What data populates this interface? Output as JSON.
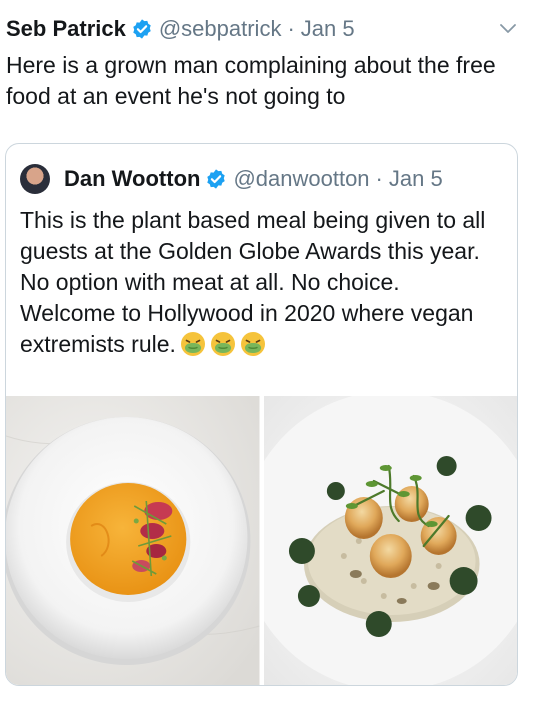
{
  "tweet": {
    "author_name": "Seb Patrick",
    "handle": "@sebpatrick",
    "separator": "·",
    "date": "Jan 5",
    "text": "Here is a grown man complaining about the free food at an event he's not going to"
  },
  "quoted_tweet": {
    "author_name": "Dan Wootton",
    "handle": "@danwootton",
    "separator": "·",
    "date": "Jan 5",
    "text": "This is the plant based meal being given to all guests at the Golden Globe Awards this year. No option with meat at all. No choice. Welcome to Hollywood in 2020 where vegan extremists rule.",
    "emojis": [
      "nauseated-face",
      "nauseated-face",
      "nauseated-face"
    ]
  },
  "colors": {
    "verified_blue": "#1da1f2",
    "secondary_text": "#657786",
    "border": "#ccd6dd"
  }
}
